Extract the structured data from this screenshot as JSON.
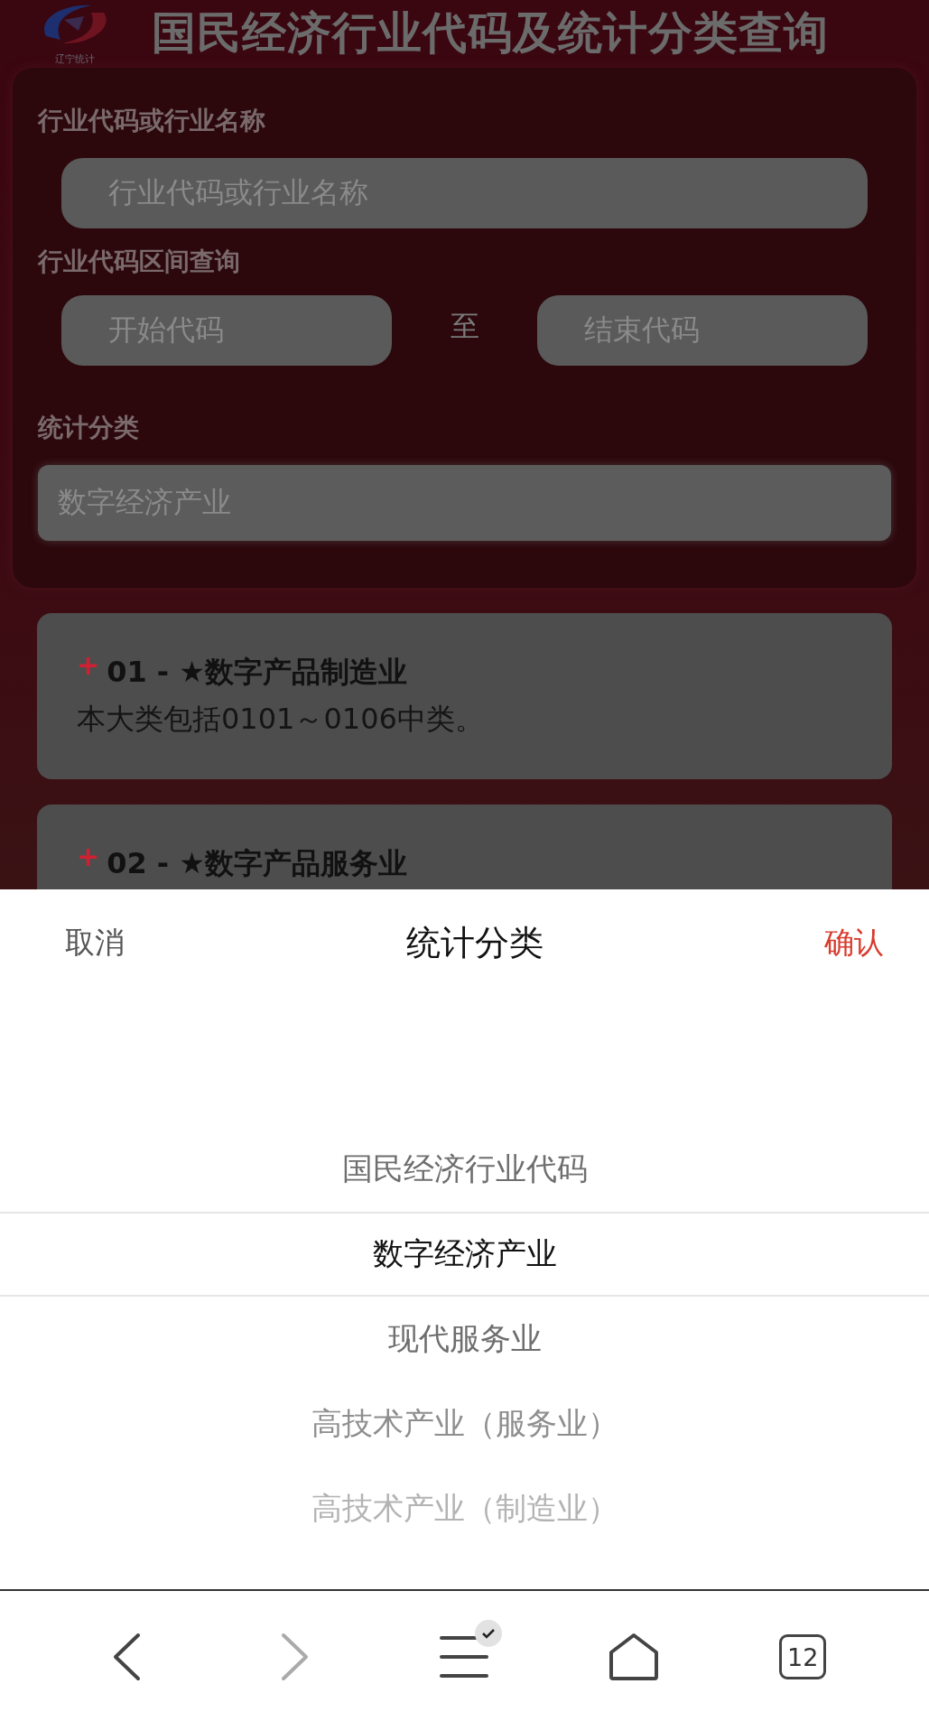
{
  "header": {
    "logo_text": "辽宁统计",
    "title": "国民经济行业代码及统计分类查询"
  },
  "search_form": {
    "name_label": "行业代码或行业名称",
    "name_field": {
      "placeholder": "行业代码或行业名称"
    },
    "range_label": "行业代码区间查询",
    "start_field": {
      "placeholder": "开始代码"
    },
    "range_separator": "至",
    "end_field": {
      "placeholder": "结束代码"
    },
    "category_label": "统计分类",
    "category_field": {
      "value": "数字经济产业"
    }
  },
  "results": [
    {
      "expand_symbol": "+",
      "title": "01 - ★数字产品制造业",
      "description": "本大类包括0101～0106中类。"
    },
    {
      "expand_symbol": "+",
      "title": "02 - ★数字产品服务业"
    }
  ],
  "picker": {
    "cancel": "取消",
    "title": "统计分类",
    "confirm": "确认",
    "options": [
      {
        "label": "国民经济行业代码",
        "selected": false
      },
      {
        "label": "数字经济产业",
        "selected": true
      },
      {
        "label": "现代服务业",
        "selected": false
      },
      {
        "label": "高技术产业（服务业）",
        "selected": false
      },
      {
        "label": "高技术产业（制造业）",
        "selected": false
      }
    ]
  },
  "browser_bar": {
    "tab_count": "12"
  }
}
